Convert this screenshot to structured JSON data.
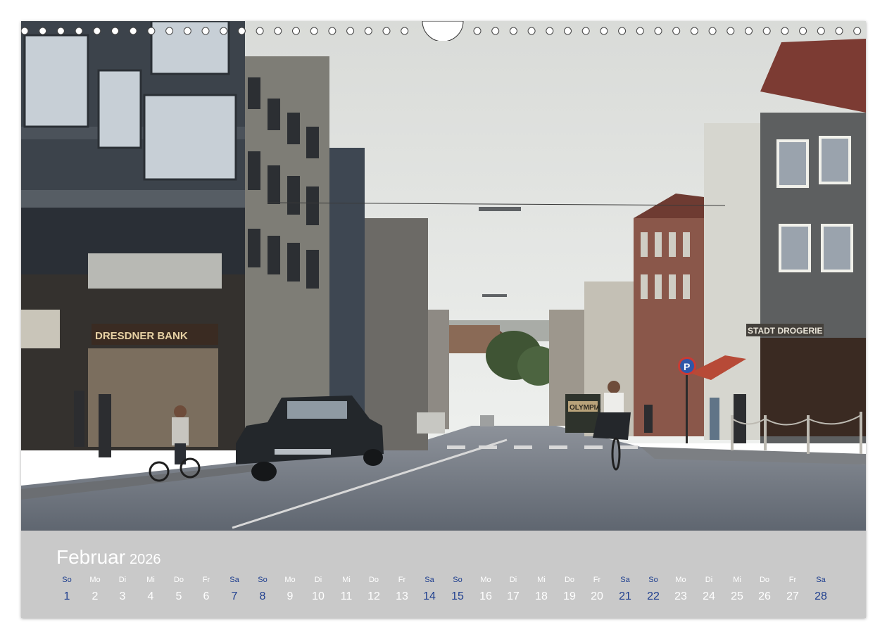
{
  "calendar": {
    "month": "Februar",
    "year": "2026",
    "accent_color": "#1f3f8f",
    "days": [
      {
        "wd": "So",
        "n": "1",
        "we": true
      },
      {
        "wd": "Mo",
        "n": "2",
        "we": false
      },
      {
        "wd": "Di",
        "n": "3",
        "we": false
      },
      {
        "wd": "Mi",
        "n": "4",
        "we": false
      },
      {
        "wd": "Do",
        "n": "5",
        "we": false
      },
      {
        "wd": "Fr",
        "n": "6",
        "we": false
      },
      {
        "wd": "Sa",
        "n": "7",
        "we": true
      },
      {
        "wd": "So",
        "n": "8",
        "we": true
      },
      {
        "wd": "Mo",
        "n": "9",
        "we": false
      },
      {
        "wd": "Di",
        "n": "10",
        "we": false
      },
      {
        "wd": "Mi",
        "n": "11",
        "we": false
      },
      {
        "wd": "Do",
        "n": "12",
        "we": false
      },
      {
        "wd": "Fr",
        "n": "13",
        "we": false
      },
      {
        "wd": "Sa",
        "n": "14",
        "we": true
      },
      {
        "wd": "So",
        "n": "15",
        "we": true
      },
      {
        "wd": "Mo",
        "n": "16",
        "we": false
      },
      {
        "wd": "Di",
        "n": "17",
        "we": false
      },
      {
        "wd": "Mi",
        "n": "18",
        "we": false
      },
      {
        "wd": "Do",
        "n": "19",
        "we": false
      },
      {
        "wd": "Fr",
        "n": "20",
        "we": false
      },
      {
        "wd": "Sa",
        "n": "21",
        "we": true
      },
      {
        "wd": "So",
        "n": "22",
        "we": true
      },
      {
        "wd": "Mo",
        "n": "23",
        "we": false
      },
      {
        "wd": "Di",
        "n": "24",
        "we": false
      },
      {
        "wd": "Mi",
        "n": "25",
        "we": false
      },
      {
        "wd": "Do",
        "n": "26",
        "we": false
      },
      {
        "wd": "Fr",
        "n": "27",
        "we": false
      },
      {
        "wd": "Sa",
        "n": "28",
        "we": true
      }
    ]
  },
  "photo": {
    "signs": {
      "bank": "DRESDNER BANK",
      "drogerie": "STADT DROGERIE",
      "olympia": "OLYMPIA",
      "parking": "P"
    }
  }
}
